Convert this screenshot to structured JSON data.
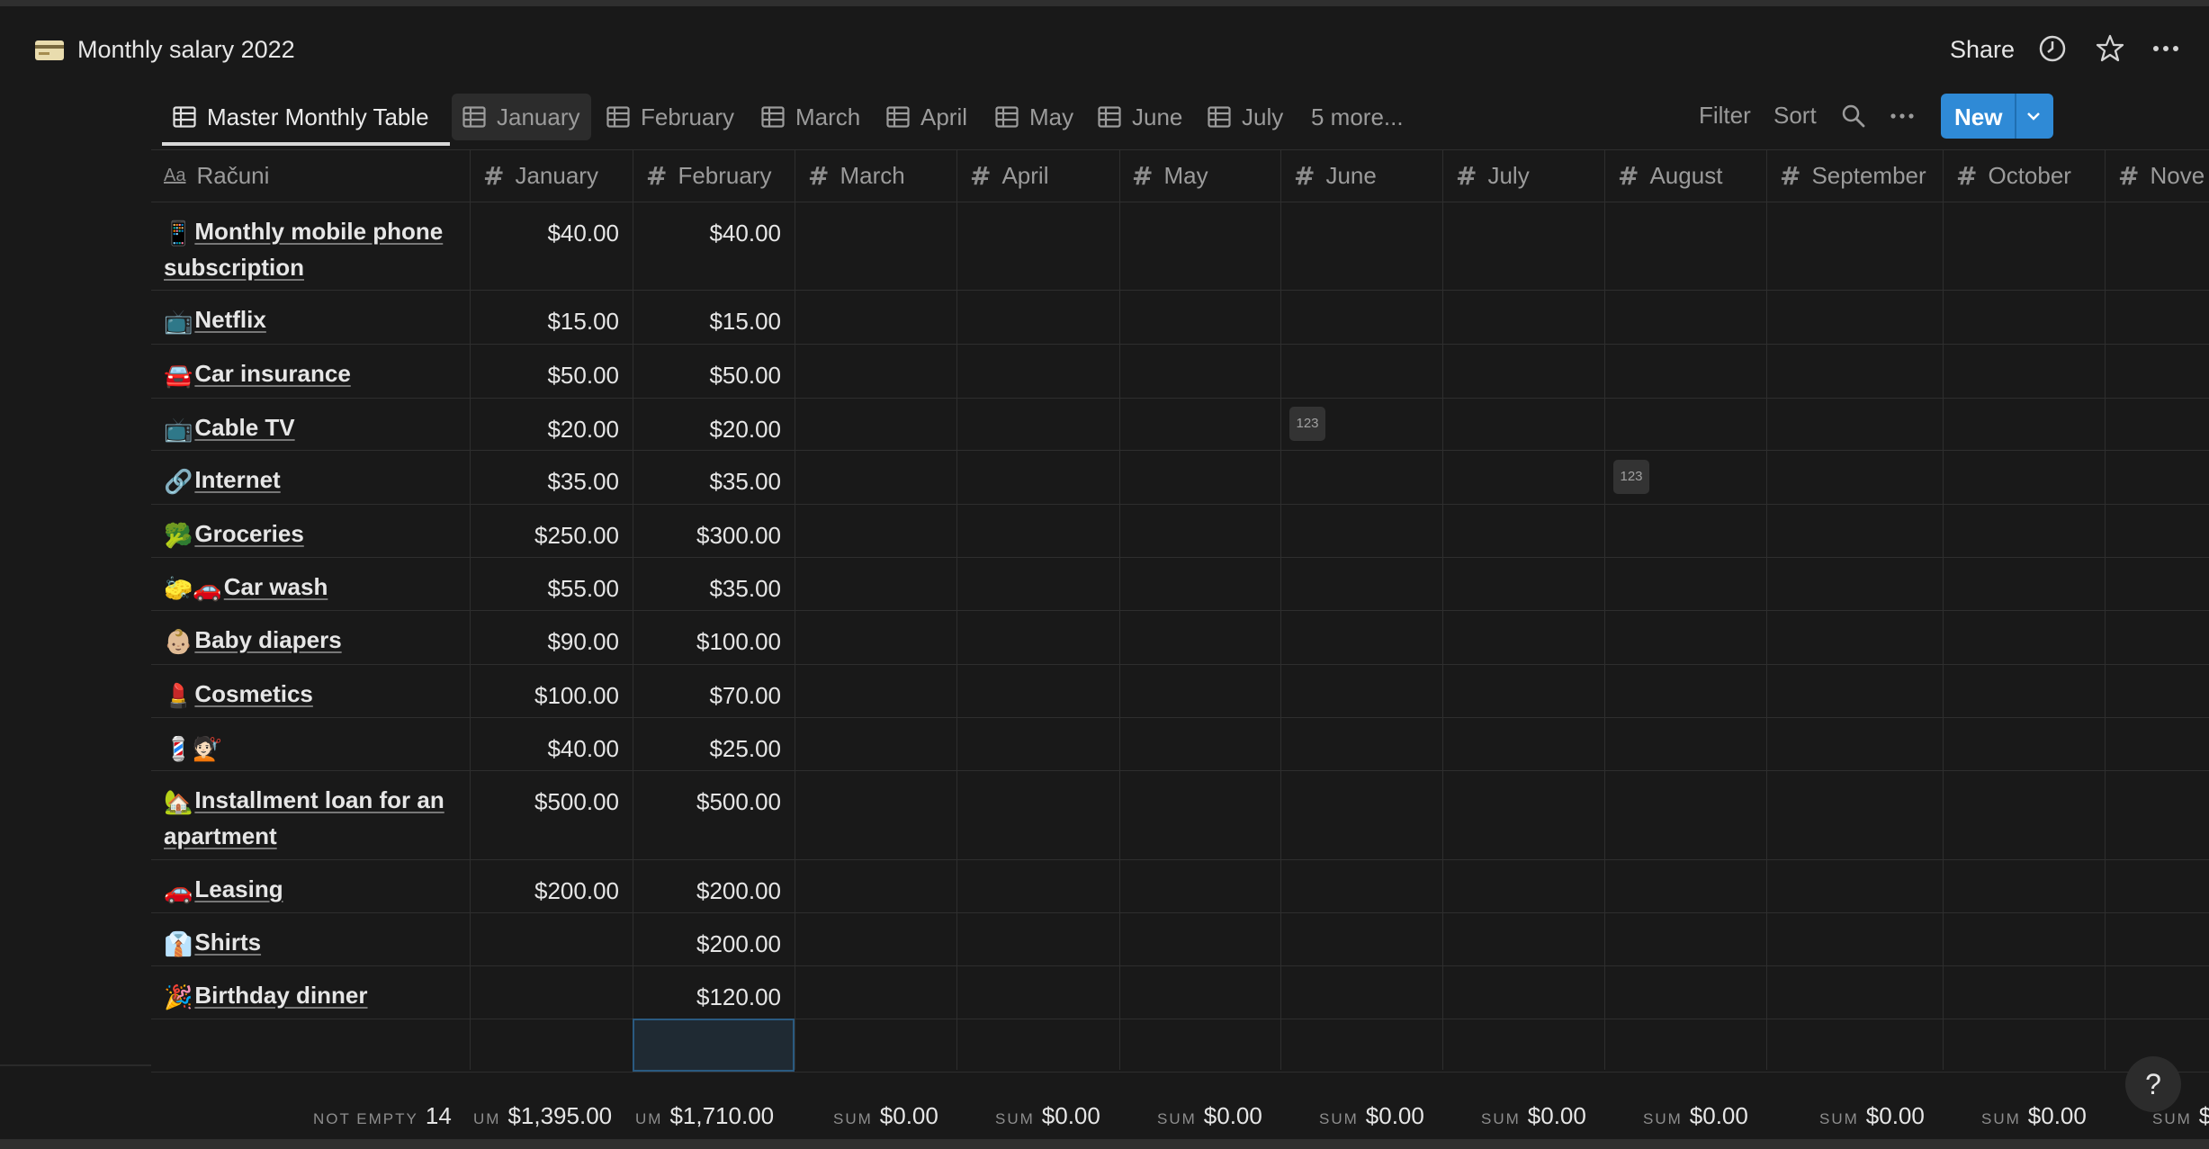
{
  "page": {
    "title": "Monthly salary 2022",
    "icon": "credit-card-icon"
  },
  "topbar": {
    "share_label": "Share",
    "icons": [
      "clock-icon",
      "star-icon",
      "more-icon"
    ]
  },
  "tabs": [
    {
      "label": "Master Monthly Table",
      "active": true
    },
    {
      "label": "January",
      "active": false
    },
    {
      "label": "February",
      "active": false
    },
    {
      "label": "March",
      "active": false
    },
    {
      "label": "April",
      "active": false
    },
    {
      "label": "May",
      "active": false
    },
    {
      "label": "June",
      "active": false
    },
    {
      "label": "July",
      "active": false
    }
  ],
  "tabs_more": "5 more...",
  "toolbar": {
    "filter": "Filter",
    "sort": "Sort",
    "new": "New"
  },
  "columns": {
    "name": "Računi",
    "months": [
      "January",
      "February",
      "March",
      "April",
      "May",
      "June",
      "July",
      "August",
      "September",
      "October",
      "Nove"
    ]
  },
  "rows": [
    {
      "emoji": "📱",
      "name": "Monthly mobile phone subscription",
      "jan": "$40.00",
      "feb": "$40.00"
    },
    {
      "emoji": "📺",
      "name": "Netflix",
      "jan": "$15.00",
      "feb": "$15.00"
    },
    {
      "emoji": "🚘",
      "name": "Car insurance",
      "jan": "$50.00",
      "feb": "$50.00"
    },
    {
      "emoji": "📺",
      "name": "Cable TV",
      "jan": "$20.00",
      "feb": "$20.00"
    },
    {
      "emoji": "🔗",
      "name": "Internet",
      "jan": "$35.00",
      "feb": "$35.00"
    },
    {
      "emoji": "🥦",
      "name": "Groceries",
      "jan": "$250.00",
      "feb": "$300.00"
    },
    {
      "emoji": "🧽🚗",
      "name": "Car wash",
      "jan": "$55.00",
      "feb": "$35.00"
    },
    {
      "emoji": "👶🏼",
      "name": "Baby diapers",
      "jan": "$90.00",
      "feb": "$100.00"
    },
    {
      "emoji": "💄",
      "name": "Cosmetics",
      "jan": "$100.00",
      "feb": "$70.00"
    },
    {
      "emoji": "💈💇🏻",
      "name": "",
      "jan": "$40.00",
      "feb": "$25.00"
    },
    {
      "emoji": "🏡",
      "name": "Installment loan for an apartment",
      "jan": "$500.00",
      "feb": "$500.00"
    },
    {
      "emoji": "🚗",
      "name": "Leasing",
      "jan": "$200.00",
      "feb": "$200.00"
    },
    {
      "emoji": "👔",
      "name": "Shirts",
      "jan": "",
      "feb": "$200.00"
    },
    {
      "emoji": "🎉",
      "name": "Birthday dinner",
      "jan": "",
      "feb": "$120.00"
    }
  ],
  "chips": {
    "june_row4": "123",
    "august_row5": "123"
  },
  "footer": {
    "not_empty_label": "NOT EMPTY",
    "not_empty_value": "14",
    "jan_label": "UM",
    "jan_value": "$1,395.00",
    "feb_label": "UM",
    "feb_value": "$1,710.00",
    "sum_label": "SUM",
    "zero_value": "$0.00",
    "last_label": "SUM",
    "last_value": "$"
  },
  "help_label": "?",
  "colors": {
    "background": "#191919",
    "accent": "#2f8ad6",
    "text": "#e6e6e6",
    "muted": "#9b9b9b"
  }
}
